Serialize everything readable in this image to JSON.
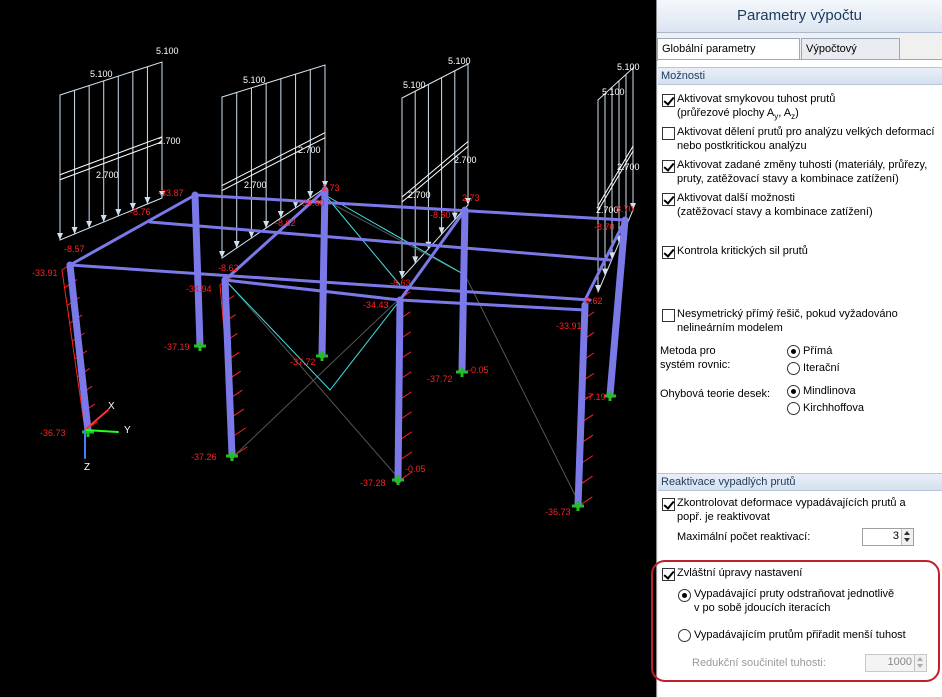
{
  "viewport": {
    "axis_labels": {
      "x": "X",
      "y": "Y",
      "z": "Z"
    },
    "load_values": {
      "f1_top": "5.100",
      "f1_top_left": "5.100",
      "f1_mid": "2.700",
      "f1_low": "2.700",
      "f2_top": "5.100",
      "f2_mid": "2.700",
      "f2_low": "2.700",
      "f3_top": "5.100",
      "f3_a": "5.100",
      "f3_mid": "2.700",
      "f3_low": "2.700",
      "f4_top": "5.100",
      "f4_a": "5.100",
      "f4_mid": "2.700",
      "f4_low": "2.700"
    },
    "result_values": {
      "r1": "-33.91",
      "r2": "-8.57",
      "r3": "-8.76",
      "r4": "-33.87",
      "r5": "-36.73",
      "r6": "-37.19",
      "r7": "-8.62",
      "r8": "-34.94",
      "r9": "-37.72",
      "r10": "-37.26",
      "r11": "-8.62",
      "r12": "-34.60",
      "r13": "2.73",
      "r14": "-34.43",
      "r15": "-8.63",
      "r16": "-37.28",
      "r17": "-0.05",
      "r18": "-37.72",
      "r19": "-0.05",
      "r20": "2.73",
      "r21": "-8.60",
      "r22": "-33.91",
      "r23": "-8.62",
      "r24": "-36.73",
      "r25": "-7.19",
      "r26": "-8.70",
      "r27": "-8.70"
    }
  },
  "panel": {
    "title": "Parametry výpočtu",
    "tabs": [
      "Globální parametry výpočtu",
      "Výpočtový diagram"
    ],
    "sections": {
      "moznosti": {
        "header": "Možnosti",
        "shear_stiffness_line1": "Aktivovat smykovou tuhost prutů",
        "shear_stiffness_line2": "(průřezové plochy A",
        "shear_sub_y": "y",
        "shear_mid": ", A",
        "shear_sub_z": "z",
        "shear_end": ")",
        "division_line1": "Aktivovat dělení prutů pro analýzu velkých deformací",
        "division_line2": "nebo postkritickou analýzu",
        "stiffness_changes_line1": "Aktivovat zadané změny tuhosti (materiály, průřezy,",
        "stiffness_changes_line2": "pruty, zatěžovací stavy a kombinace zatížení)",
        "other_options_line1": "Aktivovat další možnosti",
        "other_options_line2": "(zatěžovací stavy a kombinace zatížení)",
        "critical_forces": "Kontrola kritických sil prutů",
        "nonsym_line1": "Nesymetrický přímý řešič, pokud vyžadováno",
        "nonsym_line2": "nelineárním modelem",
        "method_label_line1": "Metoda pro",
        "method_label_line2": "systém rovnic:",
        "method_direct": "Přímá",
        "method_iterative": "Iterační",
        "plate_theory_label": "Ohybová teorie desek:",
        "plate_mindlin": "Mindlinova",
        "plate_kirchhoff": "Kirchhoffova"
      },
      "reaktivace": {
        "header": "Reaktivace vypadlých prutů",
        "check_deform_line1": "Zkontrolovat deformace vypadávajících prutů a",
        "check_deform_line2": "popř. je reaktivovat",
        "max_reactivations_label": "Maximální počet reaktivací:",
        "max_reactivations_value": "3",
        "special_settings": "Zvláštní úpravy nastavení",
        "remove_individually_line1": "Vypadávající pruty odstraňovat jednotlivě",
        "remove_individually_line2": "v po sobě jdoucích iteracích",
        "assign_lower_stiffness": "Vypadávajícím prutům přiřadit menší tuhost",
        "reduction_factor_label": "Redukční součinitel tuhosti:",
        "reduction_factor_value": "1000"
      }
    }
  }
}
